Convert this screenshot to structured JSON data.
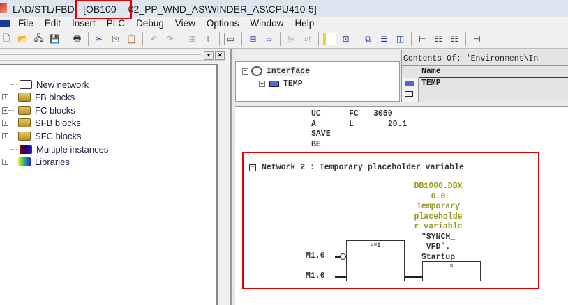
{
  "window": {
    "title_prefix": "LAD/STL/FBD",
    "title_block": " - [OB100 --",
    "title_rest": " 02_PP_WND_AS\\WINDER_AS\\CPU410-5]"
  },
  "menu": [
    "File",
    "Edit",
    "Insert",
    "PLC",
    "Debug",
    "View",
    "Options",
    "Window",
    "Help"
  ],
  "toolbar": [
    "new",
    "open",
    "accessible-nodes",
    "save",
    "print",
    "cut",
    "copy",
    "paste",
    "undo",
    "redo",
    "monitor",
    "download",
    "overview",
    "accessible",
    "program-elements",
    "catalog",
    "window-cascade",
    "window-horizontal",
    "window-vertical",
    "new-network",
    "table",
    "table2",
    "overview2"
  ],
  "tree": {
    "items": [
      {
        "label": "New network",
        "expandable": false,
        "icon": "network-icon"
      },
      {
        "label": "FB blocks",
        "expandable": true,
        "icon": "folder-block-icon"
      },
      {
        "label": "FC blocks",
        "expandable": true,
        "icon": "folder-block-icon"
      },
      {
        "label": "SFB blocks",
        "expandable": true,
        "icon": "folder-block-icon"
      },
      {
        "label": "SFC blocks",
        "expandable": true,
        "icon": "folder-block-icon"
      },
      {
        "label": "Multiple instances",
        "expandable": false,
        "icon": "books-icon"
      },
      {
        "label": "Libraries",
        "expandable": true,
        "icon": "library-icon"
      }
    ]
  },
  "interface": {
    "root": "Interface",
    "child": "TEMP"
  },
  "contents": {
    "header": "Contents Of: 'Environment\\In",
    "column": "Name",
    "row": "TEMP"
  },
  "stl": [
    [
      "UC",
      "FC",
      "3050"
    ],
    [
      "A",
      "L",
      "   20.1"
    ],
    [
      "SAVE",
      "",
      ""
    ],
    [
      "BE",
      "",
      ""
    ]
  ],
  "network": {
    "title": "Network 2",
    "sep": ":",
    "comment": "Temporary placeholder variable",
    "gate": ">=1",
    "coil": "=",
    "input1": "M1.0",
    "input2": "M1.0",
    "output_lines": [
      "DB1000.DBX",
      "0.0",
      "Temporary",
      "placeholde",
      "r variable",
      "\"SYNCH_",
      "VFD\".",
      "Startup"
    ]
  },
  "colors": {
    "highlight": "#e00000",
    "symbol": "#9a9a20"
  }
}
